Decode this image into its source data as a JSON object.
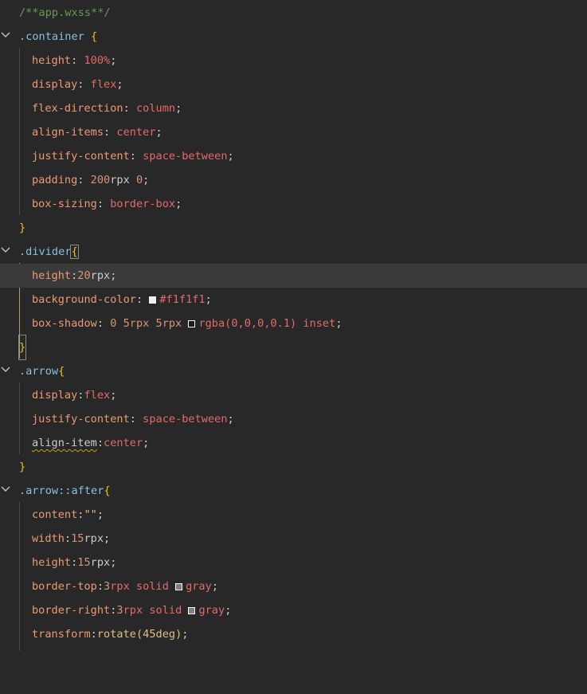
{
  "editor": {
    "file_comment": "/**app.wxss**/",
    "colors": {
      "background": "#282828",
      "active_line": "#3a3a3a",
      "comment": "#6a9955",
      "selector": "#88c0e0",
      "brace": "#f0c020",
      "property": "#ec9a73",
      "value": "#e46a6a"
    },
    "blocks": [
      {
        "selector": ".container",
        "open": " {",
        "close": "}",
        "decls": [
          {
            "prop": "height",
            "sep": ": ",
            "value": "100%",
            "end": ";"
          },
          {
            "prop": "display",
            "sep": ": ",
            "value": "flex",
            "end": ";"
          },
          {
            "prop": "flex-direction",
            "sep": ": ",
            "value": "column",
            "end": ";"
          },
          {
            "prop": "align-items",
            "sep": ": ",
            "value": "center",
            "end": ";"
          },
          {
            "prop": "justify-content",
            "sep": ": ",
            "value": "space-between",
            "end": ";"
          },
          {
            "prop": "padding",
            "sep": ": ",
            "num": "200",
            "unit": "rpx ",
            "num2": "0",
            "end": ";"
          },
          {
            "prop": "box-sizing",
            "sep": ": ",
            "value": "border-box",
            "end": ";"
          }
        ]
      },
      {
        "selector": ".divider",
        "open": "{",
        "close": "}",
        "decls": [
          {
            "prop": "height",
            "sep": ":",
            "num": "20",
            "unit": "rpx",
            "end": ";"
          },
          {
            "prop": "background-color",
            "sep": ": ",
            "swatch": "#f1f1f1",
            "value": "#f1f1f1",
            "end": ";"
          },
          {
            "prop": "box-shadow",
            "sep": ": ",
            "raw": "0 5rpx 5rpx ",
            "swatch": "rgba(0,0,0,0.1)",
            "value": "rgba(0,0,0,0.1) inset",
            "end": ";"
          }
        ]
      },
      {
        "selector": ".arrow",
        "open": "{",
        "close": "}",
        "decls": [
          {
            "prop": "display",
            "sep": ":",
            "value": "flex",
            "end": ";"
          },
          {
            "prop": "justify-content",
            "sep": ": ",
            "value": "space-between",
            "end": ";"
          },
          {
            "prop": "align-item",
            "sep": ":",
            "value": "center",
            "end": ";",
            "warning": true
          }
        ]
      },
      {
        "selector": ".arrow::after",
        "open": "{",
        "decls": [
          {
            "prop": "content",
            "sep": ":",
            "value": "\"\"",
            "end": ";"
          },
          {
            "prop": "width",
            "sep": ":",
            "num": "15",
            "unit": "rpx",
            "end": ";"
          },
          {
            "prop": "height",
            "sep": ":",
            "num": "15",
            "unit": "rpx",
            "end": ";"
          },
          {
            "prop": "border-top",
            "sep": ":",
            "num": "3",
            "unit": "rpx solid ",
            "swatch": "gray",
            "value": "gray",
            "end": ";"
          },
          {
            "prop": "border-right",
            "sep": ":",
            "num": "3",
            "unit": "rpx solid ",
            "swatch": "gray",
            "value": "gray",
            "end": ";"
          },
          {
            "prop": "transform",
            "sep": ":",
            "value": "rotate(45deg)",
            "end": ";"
          }
        ]
      }
    ]
  }
}
